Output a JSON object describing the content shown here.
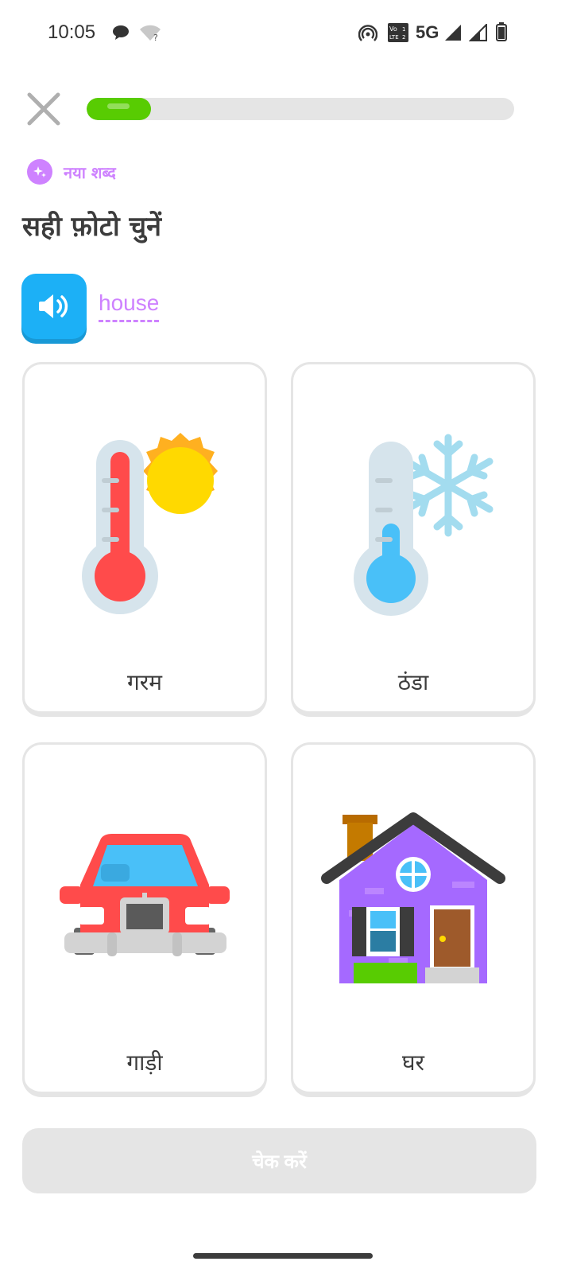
{
  "status_bar": {
    "time": "10:05",
    "network": "5G",
    "icons": [
      "message-icon",
      "wifi-question-icon",
      "hotspot-icon",
      "volte-icon",
      "signal-icon",
      "signal-icon",
      "battery-icon"
    ]
  },
  "header": {
    "close_icon": "close-icon",
    "progress": 0.15,
    "progress_color": "#58cc02"
  },
  "badge": {
    "label": "नया शब्द",
    "color": "#ce82ff"
  },
  "prompt": {
    "title": "सही फ़ोटो चुनें",
    "word": "house",
    "speaker_icon": "speaker-icon",
    "speaker_color": "#1cb0f6"
  },
  "options": [
    {
      "label": "गरम",
      "icon": "hot-thermometer-sun-icon"
    },
    {
      "label": "ठंडा",
      "icon": "cold-thermometer-snowflake-icon"
    },
    {
      "label": "गाड़ी",
      "icon": "car-icon"
    },
    {
      "label": "घर",
      "icon": "house-icon"
    }
  ],
  "footer": {
    "check_label": "चेक करें"
  }
}
